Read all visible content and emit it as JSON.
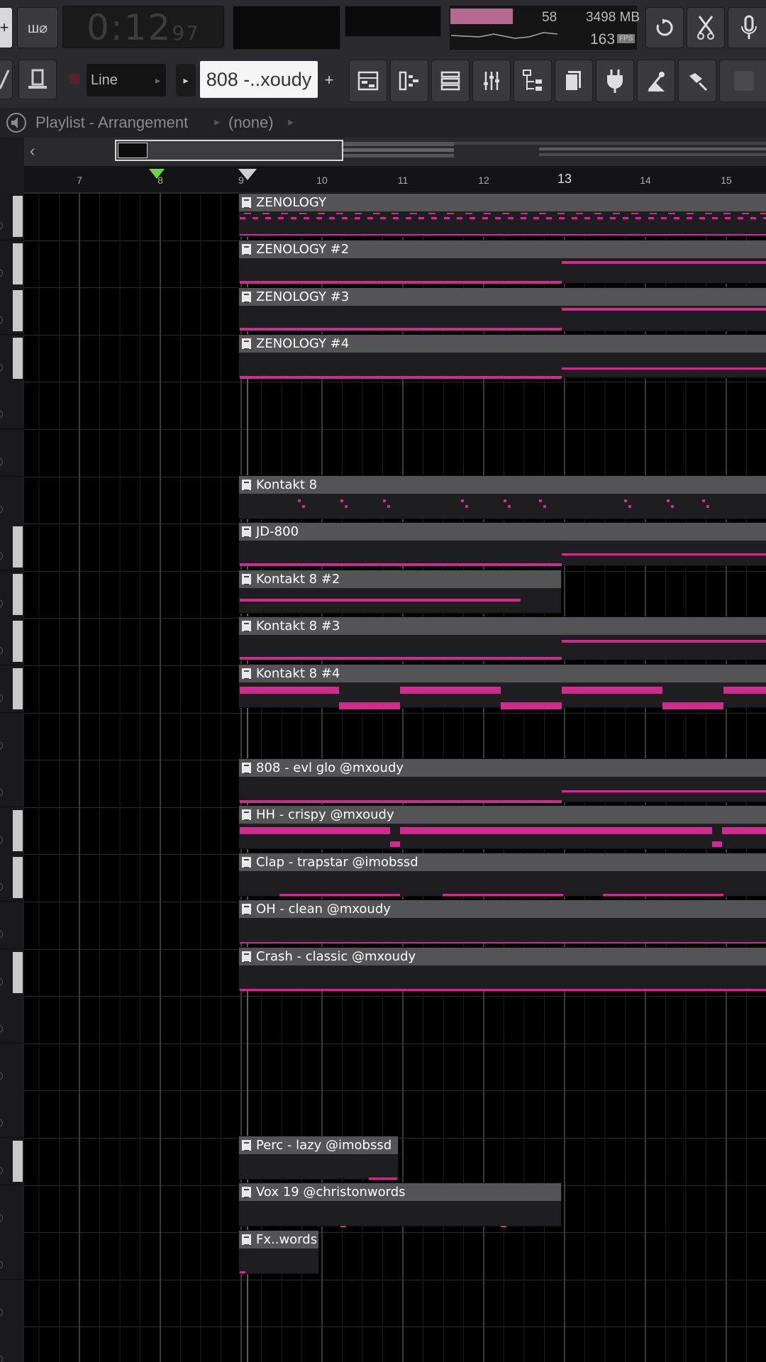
{
  "toolbar": {
    "time": "0:12",
    "time_ms": "97",
    "cpu_value": "58",
    "memory": "3498 MB",
    "polyphony": "163",
    "poly_badge": "FPS",
    "snap_mode": "Line",
    "pattern_name": "808 -..xoudy",
    "add_label": "+"
  },
  "playlist": {
    "title": "Playlist - Arrangement",
    "selection": "(none)"
  },
  "ruler": {
    "bars": [
      "7",
      "8",
      "9",
      "10",
      "11",
      "12",
      "13",
      "14",
      "15"
    ]
  },
  "clips": {
    "zenology": "ZENOLOGY",
    "zenology2": "ZENOLOGY #2",
    "zenology3": "ZENOLOGY #3",
    "zenology4": "ZENOLOGY #4",
    "kontakt8": "Kontakt 8",
    "jd800": "JD-800",
    "kontakt8_2": "Kontakt 8 #2",
    "kontakt8_3": "Kontakt 8 #3",
    "kontakt8_4": "Kontakt 8 #4",
    "eight08": "808 - evl glo @mxoudy",
    "hh": "HH - crispy @mxoudy",
    "clap": "Clap - trapstar @imobssd",
    "oh": "OH - clean @mxoudy",
    "crash": "Crash - classic @mxoudy",
    "perc": "Perc - lazy @imobssd",
    "vox": "Vox 19 @christonwords",
    "fx": "Fx..words"
  },
  "colors": {
    "note": "#d12b8f",
    "background": "#000000",
    "clip_header": "#545456"
  }
}
